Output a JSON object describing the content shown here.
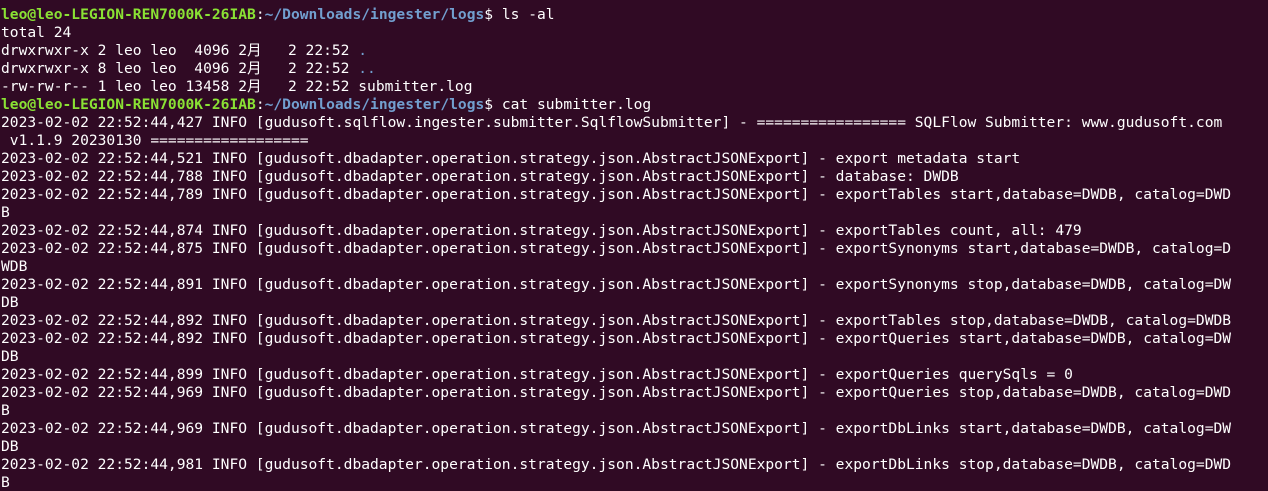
{
  "colors": {
    "background": "#300a24",
    "foreground": "#ffffff",
    "prompt_user": "#8ae234",
    "prompt_path": "#729fcf",
    "directory": "#729fcf"
  },
  "prompt": {
    "user_host": "leo@leo-LEGION-REN7000K-26IAB",
    "path": "~/Downloads/ingester/logs"
  },
  "commands": {
    "first": "ls -al",
    "second": "cat submitter.log"
  },
  "ls_output": {
    "total": "total 24",
    "entries": [
      {
        "meta": "drwxrwxr-x 2 leo leo  4096 2月   2 22:52 ",
        "name": "."
      },
      {
        "meta": "drwxrwxr-x 8 leo leo  4096 2月   2 22:52 ",
        "name": ".."
      },
      {
        "meta": "-rw-rw-r-- 1 leo leo 13458 2月   2 22:52 ",
        "name": "submitter.log"
      }
    ]
  },
  "log_lines": [
    "2023-02-02 22:52:44,427 INFO [gudusoft.sqlflow.ingester.submitter.SqlflowSubmitter] - ================= SQLFlow Submitter: www.gudusoft.com",
    " v1.1.9 20230130 ==================",
    "2023-02-02 22:52:44,521 INFO [gudusoft.dbadapter.operation.strategy.json.AbstractJSONExport] - export metadata start",
    "2023-02-02 22:52:44,788 INFO [gudusoft.dbadapter.operation.strategy.json.AbstractJSONExport] - database: DWDB",
    "2023-02-02 22:52:44,789 INFO [gudusoft.dbadapter.operation.strategy.json.AbstractJSONExport] - exportTables start,database=DWDB, catalog=DWD",
    "B",
    "2023-02-02 22:52:44,874 INFO [gudusoft.dbadapter.operation.strategy.json.AbstractJSONExport] - exportTables count, all: 479",
    "2023-02-02 22:52:44,875 INFO [gudusoft.dbadapter.operation.strategy.json.AbstractJSONExport] - exportSynonyms start,database=DWDB, catalog=D",
    "WDB",
    "2023-02-02 22:52:44,891 INFO [gudusoft.dbadapter.operation.strategy.json.AbstractJSONExport] - exportSynonyms stop,database=DWDB, catalog=DW",
    "DB",
    "2023-02-02 22:52:44,892 INFO [gudusoft.dbadapter.operation.strategy.json.AbstractJSONExport] - exportTables stop,database=DWDB, catalog=DWDB",
    "2023-02-02 22:52:44,892 INFO [gudusoft.dbadapter.operation.strategy.json.AbstractJSONExport] - exportQueries start,database=DWDB, catalog=DW",
    "DB",
    "2023-02-02 22:52:44,899 INFO [gudusoft.dbadapter.operation.strategy.json.AbstractJSONExport] - exportQueries querySqls = 0",
    "2023-02-02 22:52:44,969 INFO [gudusoft.dbadapter.operation.strategy.json.AbstractJSONExport] - exportQueries stop,database=DWDB, catalog=DWD",
    "B",
    "2023-02-02 22:52:44,969 INFO [gudusoft.dbadapter.operation.strategy.json.AbstractJSONExport] - exportDbLinks start,database=DWDB, catalog=DW",
    "DB",
    "2023-02-02 22:52:44,981 INFO [gudusoft.dbadapter.operation.strategy.json.AbstractJSONExport] - exportDbLinks stop,database=DWDB, catalog=DWD",
    "B"
  ]
}
